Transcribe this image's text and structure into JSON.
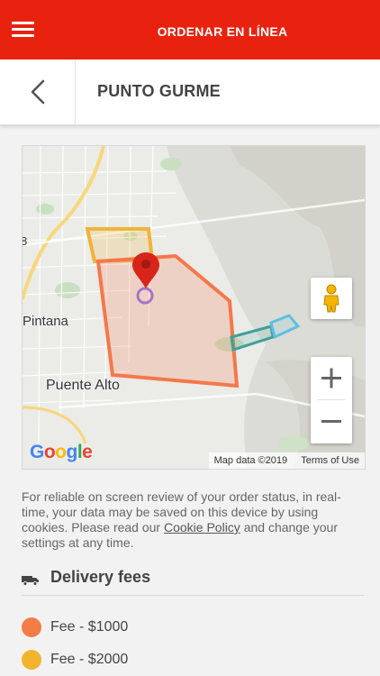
{
  "topbar": {
    "title": "ORDENAR EN LÍNEA"
  },
  "header": {
    "restaurant_name": "PUNTO GURME"
  },
  "map": {
    "places": {
      "puente_alto": "Puente Alto",
      "pintana": "Pintana"
    },
    "attribution": {
      "map_data": "Map data ©2019",
      "terms": "Terms of Use"
    },
    "google_logo": "Google",
    "zoom_in": "+",
    "zoom_out": "−",
    "zone_colors": [
      "#f4784a",
      "#f0b43a",
      "#3f9f99",
      "#5cc0e0"
    ],
    "marker_color": "#d8251a"
  },
  "cookie_notice": {
    "text_before": "For reliable on screen review of your order status, in real-time, your data may be saved on this device by using cookies. Please read our ",
    "link": "Cookie Policy",
    "text_after": " and change your settings at any time."
  },
  "delivery": {
    "title": "Delivery fees",
    "fees": [
      {
        "label": "Fee - $1000",
        "color": "#f47c47"
      },
      {
        "label": "Fee - $2000",
        "color": "#f2b42e"
      }
    ]
  }
}
